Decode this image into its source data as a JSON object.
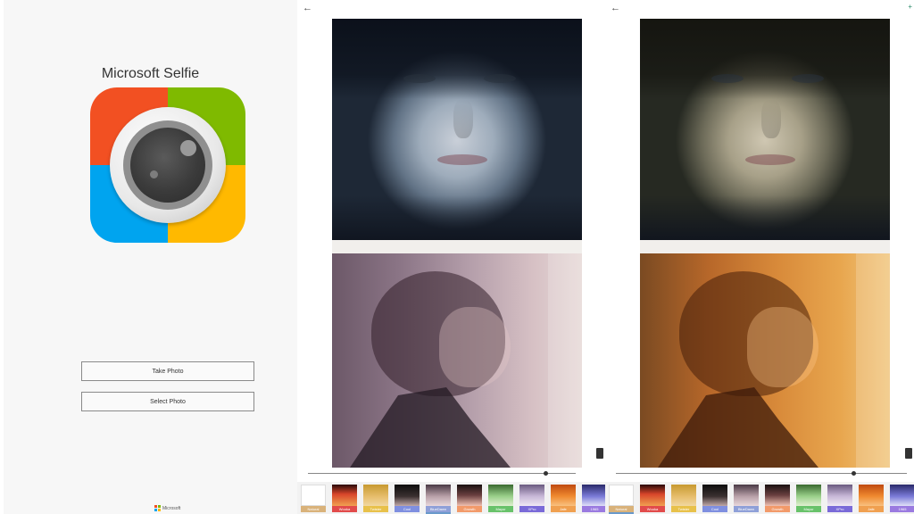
{
  "launch": {
    "app_title": "Microsoft Selfie",
    "logo_colors": [
      "#F25022",
      "#7FBA00",
      "#00A4EF",
      "#FFB900"
    ],
    "take_photo_label": "Take Photo",
    "select_photo_label": "Select Photo",
    "footer_brand": "Microsoft"
  },
  "editor_left": {
    "back_icon": "arrow-left-icon",
    "slider_value": 0.9,
    "selected_filter": "BlueDawn",
    "filters": [
      {
        "name": "Natural",
        "label_color": "#d9b27a"
      },
      {
        "name": "Wooka",
        "label_color": "#e24b4b"
      },
      {
        "name": "Twister",
        "label_color": "#e8c14a"
      },
      {
        "name": "Cool",
        "label_color": "#7f8fe0"
      },
      {
        "name": "BlueDawn",
        "label_color": "#8fa0d8"
      },
      {
        "name": "Growth",
        "label_color": "#f29a6a"
      },
      {
        "name": "Mayor",
        "label_color": "#68c26a"
      },
      {
        "name": "XPro",
        "label_color": "#7a6ad8"
      },
      {
        "name": "Jafe",
        "label_color": "#f0a050"
      },
      {
        "name": "1965",
        "label_color": "#9a7ae0"
      }
    ]
  },
  "editor_right": {
    "back_icon": "arrow-left-icon",
    "top_right_glyph": "+",
    "slider_value": 0.85,
    "selected_filter": "Natural",
    "filters": [
      {
        "name": "Natural",
        "label_color": "#d9b27a"
      },
      {
        "name": "Wooka",
        "label_color": "#e24b4b"
      },
      {
        "name": "Twister",
        "label_color": "#e8c14a"
      },
      {
        "name": "Cool",
        "label_color": "#7f8fe0"
      },
      {
        "name": "BlueDawn",
        "label_color": "#8fa0d8"
      },
      {
        "name": "Growth",
        "label_color": "#f29a6a"
      },
      {
        "name": "Mayor",
        "label_color": "#68c26a"
      },
      {
        "name": "XPro",
        "label_color": "#7a6ad8"
      },
      {
        "name": "Jafe",
        "label_color": "#f0a050"
      },
      {
        "name": "1965",
        "label_color": "#9a7ae0"
      }
    ]
  }
}
